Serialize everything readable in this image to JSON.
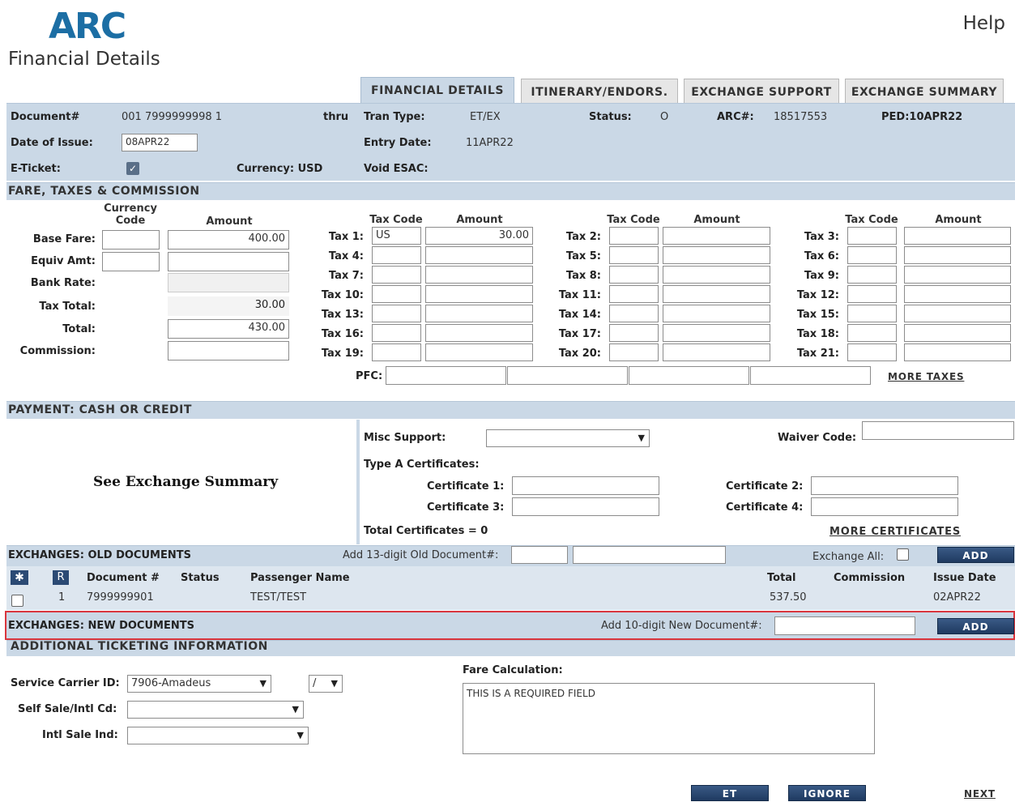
{
  "header": {
    "logo": "ARC",
    "title": "Financial Details",
    "help": "Help"
  },
  "tabs": [
    "FINANCIAL DETAILS",
    "ITINERARY/ENDORS.",
    "EXCHANGE SUPPORT",
    "EXCHANGE SUMMARY"
  ],
  "doc": {
    "document_label": "Document#",
    "document_value": "001 7999999998 1",
    "thru": "thru",
    "tran_type_label": "Tran Type:",
    "tran_type_value": "ET/EX",
    "status_label": "Status:",
    "status_value": "O",
    "arc_label": "ARC#:",
    "arc_value": "18517553",
    "ped": "PED:10APR22",
    "issue_label": "Date of Issue:",
    "issue_value": "08APR22",
    "entry_label": "Entry Date:",
    "entry_value": "11APR22",
    "eticket_label": "E-Ticket:",
    "currency": "Currency: USD",
    "void_label": "Void ESAC:"
  },
  "fare": {
    "section_title": "FARE, TAXES & COMMISSION",
    "currency_code_head": "Currency Code",
    "amount_head": "Amount",
    "base_fare_label": "Base Fare:",
    "base_fare_amount": "400.00",
    "equiv_label": "Equiv Amt:",
    "bank_rate_label": "Bank Rate:",
    "tax_total_label": "Tax Total:",
    "tax_total_value": "30.00",
    "total_label": "Total:",
    "total_value": "430.00",
    "commission_label": "Commission:",
    "tax_code_head": "Tax Code",
    "tax_amount_head": "Amount",
    "tax_labels": [
      "Tax 1:",
      "Tax 2:",
      "Tax 3:",
      "Tax 4:",
      "Tax 5:",
      "Tax 6:",
      "Tax 7:",
      "Tax 8:",
      "Tax 9:",
      "Tax 10:",
      "Tax 11:",
      "Tax 12:",
      "Tax 13:",
      "Tax 14:",
      "Tax 15:",
      "Tax 16:",
      "Tax 17:",
      "Tax 18:",
      "Tax 19:",
      "Tax 20:",
      "Tax 21:"
    ],
    "tax1_code": "US",
    "tax1_amount": "30.00",
    "pfc_label": "PFC:",
    "more_taxes": "MORE TAXES"
  },
  "payment": {
    "section_title": "PAYMENT: CASH OR CREDIT",
    "see_summary": "See Exchange Summary",
    "misc_label": "Misc Support:",
    "waiver_label": "Waiver Code:",
    "type_a_label": "Type A Certificates:",
    "cert1": "Certificate 1:",
    "cert2": "Certificate 2:",
    "cert3": "Certificate 3:",
    "cert4": "Certificate 4:",
    "total_certs": "Total Certificates = 0",
    "more_certs": "MORE CERTIFICATES"
  },
  "old_docs": {
    "section_title": "EXCHANGES: OLD DOCUMENTS",
    "add_label": "Add 13-digit Old Document#:",
    "exchange_all": "Exchange All:",
    "add_button": "ADD",
    "head_star": "✱",
    "head_r": "R",
    "columns": [
      "Document #",
      "Status",
      "Passenger Name",
      "Total",
      "Commission",
      "Issue Date"
    ],
    "row": {
      "num": "1",
      "document": "7999999901",
      "status": "",
      "passenger": "TEST/TEST",
      "total": "537.50",
      "commission": "",
      "issue_date": "02APR22"
    }
  },
  "new_docs": {
    "section_title": "EXCHANGES: NEW DOCUMENTS",
    "add_label": "Add 10-digit New Document#:",
    "add_button": "ADD"
  },
  "additional": {
    "section_title": "ADDITIONAL TICKETING INFORMATION",
    "carrier_label": "Service Carrier ID:",
    "carrier_value": "7906-Amadeus",
    "slash_value": "/",
    "self_sale_label": "Self Sale/Intl Cd:",
    "intl_label": "Intl Sale Ind:",
    "fare_calc_label": "Fare Calculation:",
    "fare_calc_value": "THIS IS A REQUIRED FIELD"
  },
  "footer": {
    "et_button": "ET",
    "ignore_button": "IGNORE",
    "next": "NEXT"
  },
  "colors": {
    "band": "#cad8e6",
    "button": "#1f3a60",
    "logo": "#1c6ea4",
    "highlight": "#d9363e"
  }
}
